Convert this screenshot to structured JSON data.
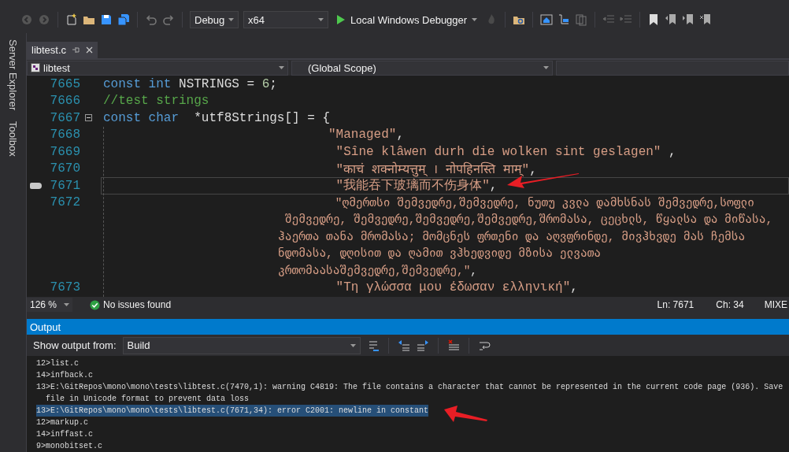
{
  "toolbar": {
    "configuration": "Debug",
    "platform": "x64",
    "run_label": "Local Windows Debugger"
  },
  "side_tabs": [
    "Server Explorer",
    "Toolbox"
  ],
  "document_tabs": [
    {
      "label": "libtest.c",
      "selected": true
    }
  ],
  "nav_bar": {
    "project": "libtest",
    "scope": "(Global Scope)"
  },
  "code_lines": [
    {
      "number": "7665",
      "kind": "statement",
      "current": false,
      "foldable": false,
      "rows": [
        [
          {
            "kind": "keyword",
            "text": "const int"
          },
          {
            "kind": "plain",
            "text": " NSTRINGS = "
          },
          {
            "kind": "number",
            "text": "6"
          },
          {
            "kind": "plain",
            "text": ";"
          }
        ]
      ]
    },
    {
      "number": "7666",
      "kind": "statement",
      "current": false,
      "foldable": false,
      "rows": [
        [
          {
            "kind": "comment",
            "text": "//test strings"
          }
        ]
      ]
    },
    {
      "number": "7667",
      "kind": "statement",
      "current": false,
      "foldable": true,
      "rows": [
        [
          {
            "kind": "keyword",
            "text": "const char"
          },
          {
            "kind": "plain",
            "text": "  *utf8Strings[] = {"
          }
        ]
      ]
    },
    {
      "number": "7668",
      "kind": "entry",
      "current": false,
      "foldable": false,
      "rows": [
        [
          {
            "kind": "string",
            "text": "\"Managed\""
          },
          {
            "kind": "plain",
            "text": ","
          }
        ]
      ]
    },
    {
      "number": "7669",
      "kind": "entry",
      "current": false,
      "foldable": false,
      "rows": [
        [
          {
            "kind": "string",
            "text": " \"Sîne klâwen durh die wolken sint geslagen\""
          },
          {
            "kind": "plain",
            "text": " ,"
          }
        ]
      ]
    },
    {
      "number": "7670",
      "kind": "entry",
      "current": false,
      "foldable": false,
      "rows": [
        [
          {
            "kind": "string",
            "text": " \"काचं शक्नोम्यत्तुम् । नोपहिनस्ति माम्\""
          },
          {
            "kind": "plain",
            "text": ","
          }
        ]
      ]
    },
    {
      "number": "7671",
      "kind": "entry",
      "current": true,
      "foldable": false,
      "rows": [
        [
          {
            "kind": "string",
            "text": " \"我能吞下玻璃而不伤身体\""
          },
          {
            "kind": "plain",
            "text": ","
          }
        ]
      ]
    },
    {
      "number": "7672",
      "kind": "entry",
      "current": false,
      "foldable": false,
      "rows": [
        [
          {
            "kind": "string",
            "text": " \"ღმერთსი შემვედრე,შემვედრე, ნუთუ კვლა დამხსნას შემვედრე,სოფლი"
          }
        ],
        [
          {
            "kind": "string",
            "text": " შემვედრე, შემვედრე,შემვედრე,შემვედრე,შრომასა, ცეცხლს, წყალსა და მიწასა,"
          }
        ],
        [
          {
            "kind": "string",
            "text": "ჰაერთა თანა მრომასა; მომცნეს ფრთენი და აღვფრინდე, მივჰხვდე მას ჩემსა"
          }
        ],
        [
          {
            "kind": "string",
            "text": "ნდომასა, დღისით და ღამით ვჰხედვიდე მზისა ელვათა"
          }
        ],
        [
          {
            "kind": "string",
            "text": "კრთომაასაშემვედრე,შემვედრე,\""
          },
          {
            "kind": "plain",
            "text": ","
          }
        ]
      ]
    },
    {
      "number": "7673",
      "kind": "entry",
      "current": false,
      "foldable": false,
      "rows": [
        [
          {
            "kind": "string",
            "text": " \"Τη γλώσσα μου έδωσαν ελληνική\""
          },
          {
            "kind": "plain",
            "text": ","
          }
        ]
      ]
    }
  ],
  "status": {
    "zoom": "126 %",
    "issues": "No issues found",
    "line": "Ln: 7671",
    "column": "Ch: 34",
    "encoding": "MIXE"
  },
  "output": {
    "title": "Output",
    "source_label": "Show output from:",
    "source": "Build",
    "lines": [
      {
        "text": "12>list.c",
        "selected": false
      },
      {
        "text": "14>infback.c",
        "selected": false
      },
      {
        "text": "13>E:\\GitRepos\\mono\\mono\\tests\\libtest.c(7470,1): warning C4819: The file contains a character that cannot be represented in the current code page (936). Save",
        "selected": false
      },
      {
        "text": "  file in Unicode format to prevent data loss",
        "selected": false
      },
      {
        "text": "13>E:\\GitRepos\\mono\\mono\\tests\\libtest.c(7671,34): error C2001: newline in constant",
        "selected": true
      },
      {
        "text": "12>markup.c",
        "selected": false
      },
      {
        "text": "14>inffast.c",
        "selected": false
      },
      {
        "text": "9>monobitset.c",
        "selected": false
      }
    ]
  }
}
